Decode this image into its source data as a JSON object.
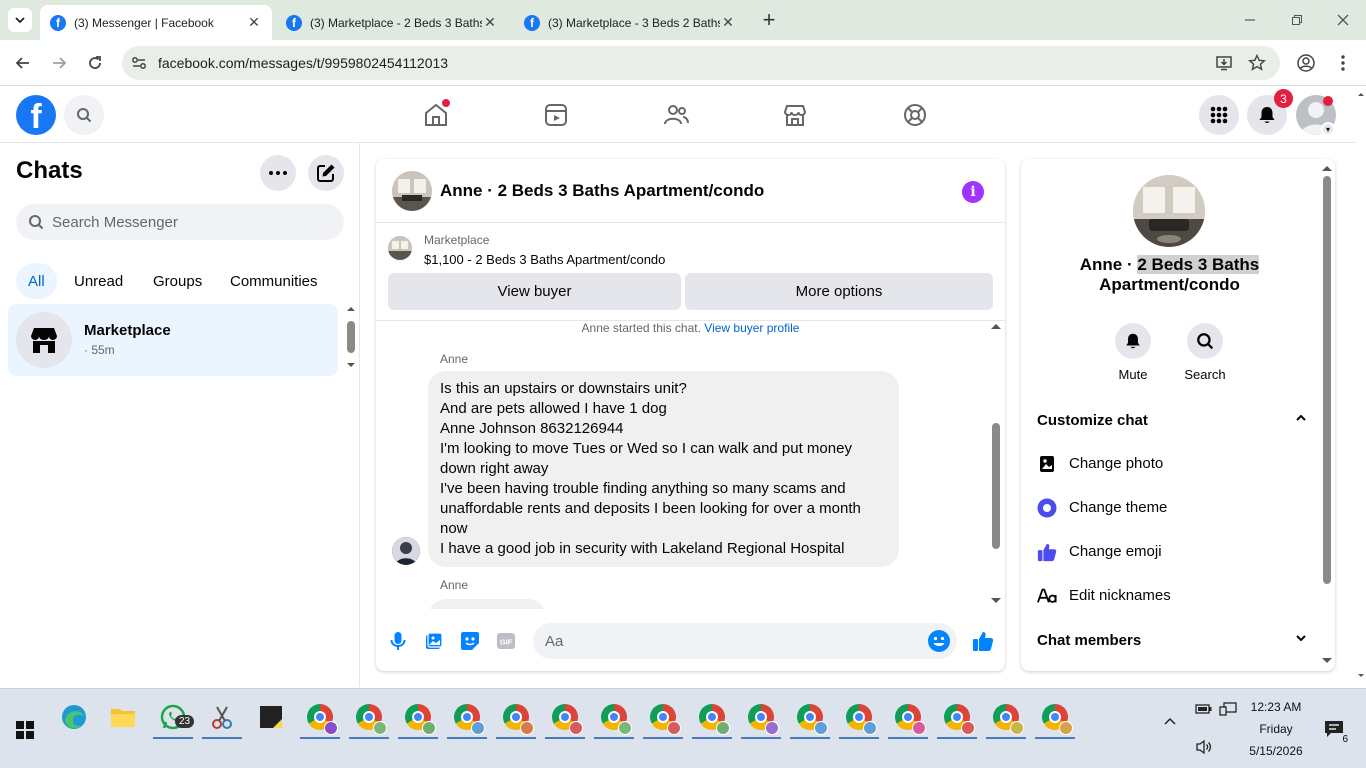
{
  "browser": {
    "tabs": [
      {
        "title": "(3) Messenger | Facebook",
        "active": true
      },
      {
        "title": "(3) Marketplace - 2 Beds 3 Baths",
        "active": false
      },
      {
        "title": "(3) Marketplace - 3 Beds 2 Baths",
        "active": false
      }
    ],
    "url": "facebook.com/messages/t/9959802454112013"
  },
  "fb_header": {
    "logo": "f",
    "notifications_count": "3"
  },
  "chats_panel": {
    "title": "Chats",
    "search_placeholder": "Search Messenger",
    "filters": [
      "All",
      "Unread",
      "Groups",
      "Communities"
    ],
    "active_filter": "All",
    "chat_list": [
      {
        "name": "Marketplace",
        "meta": "· 55m"
      }
    ]
  },
  "conversation": {
    "title": "Anne · 2 Beds 3 Baths Apartment/condo",
    "marketplace_label": "Marketplace",
    "listing": "$1,100 - 2 Beds 3 Baths Apartment/condo",
    "view_buyer": "View buyer",
    "more_options": "More options",
    "started_text": "Anne started this chat.",
    "buyer_profile_link": "View buyer profile",
    "messages": [
      {
        "sender": "Anne",
        "lines": [
          "Is this an upstairs or downstairs unit?",
          "And are pets allowed I have 1 dog",
          "Anne Johnson 8632126944",
          "I'm looking to move Tues or Wed so I can walk and put money down right away",
          "I've been having trouble finding anything so many scams and unaffordable rents and deposits I been looking for over a month now",
          "I have a good job in security with Lakeland Regional Hospital"
        ]
      },
      {
        "sender": "Anne"
      }
    ],
    "composer_placeholder": "Aa"
  },
  "details_panel": {
    "name_plain": "Anne · ",
    "name_highlight": "2 Beds 3 Baths",
    "name_line2": "Apartment/condo",
    "actions": [
      "Mute",
      "Search"
    ],
    "customize_chat": "Customize chat",
    "options": [
      "Change photo",
      "Change theme",
      "Change emoji",
      "Edit nicknames"
    ],
    "chat_members": "Chat members",
    "theme_color": "#4b4bf0",
    "accent_color": "#0084ff"
  },
  "taskbar": {
    "whatsapp_badge": "23",
    "time": "12:23 AM",
    "day": "Friday",
    "date": "5/15/2026",
    "notification_count": "6"
  }
}
